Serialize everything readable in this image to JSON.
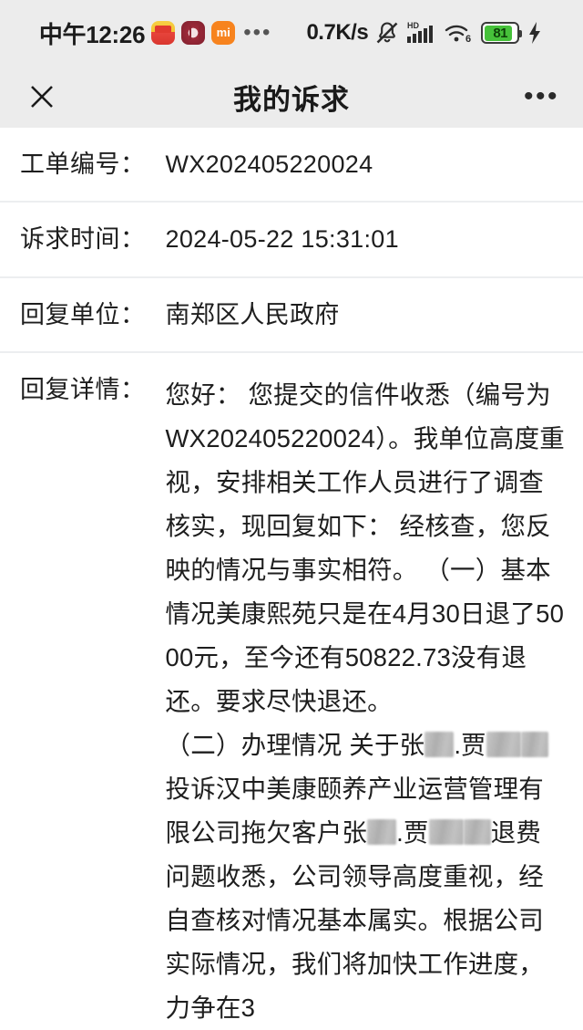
{
  "statusbar": {
    "time": "中午12:26",
    "app_icons": [
      "meituan-app-icon",
      "radio-app-icon",
      "mi-app-icon"
    ],
    "overflow_dots": "•••",
    "net_speed": "0.7K/s",
    "icons": [
      "mute-bell-icon",
      "hd-signal-icon",
      "wifi6-icon",
      "battery-icon",
      "charging-bolt-icon"
    ],
    "battery_level": "81",
    "battery_color": "#46c13a",
    "wifi_label": "6",
    "hd_label": "HD"
  },
  "titlebar": {
    "close_icon": "close-icon",
    "title": "我的诉求",
    "more_icon": "•••"
  },
  "fields": {
    "order_no_label": "工单编号：",
    "order_no_value": "WX202405220024",
    "time_label": "诉求时间：",
    "time_value": "2024-05-22 15:31:01",
    "unit_label": "回复单位：",
    "unit_value": "南郑区人民政府",
    "detail_label": "回复详情："
  },
  "detail": {
    "part1": "您好： 您提交的信件收悉（编号为WX202405220024）。我单位高度重视，安排相关工作人员进行了调查核实，现回复如下： 经核查，您反映的情况与事实相符。 （一）基本情况美康熙苑只是在4月30日退了5000元，至今还有50822.73没有退还。要求尽快退还。\n（二）办理情况 关于张",
    "part2": ".贾",
    "part3": "投诉汉中美康颐养产业运营管理有限公司拖欠客户张",
    "part4": ".贾",
    "part5": "退费问题收悉，公司领导高度重视，经自查核对情况基本属实。根据公司实际情况，我们将加快工作进度，力争在3"
  }
}
